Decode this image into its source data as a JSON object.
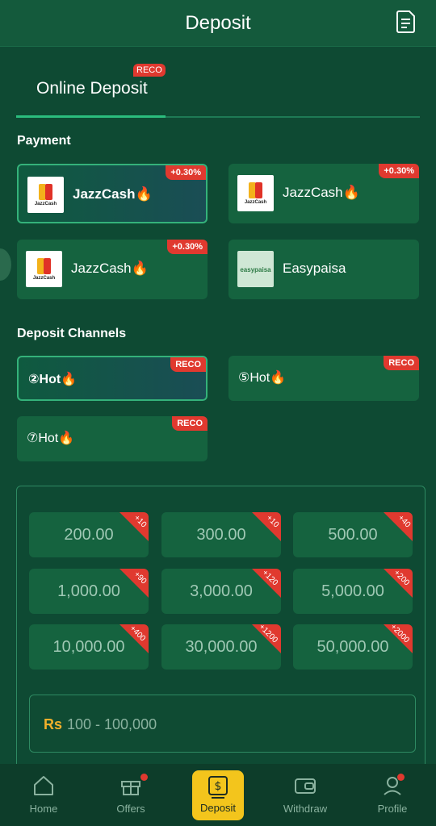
{
  "header": {
    "title": "Deposit"
  },
  "tabs": {
    "active_label": "Online Deposit",
    "reco_badge": "RECO"
  },
  "payment": {
    "section_title": "Payment",
    "methods": [
      {
        "name": "JazzCash🔥",
        "bonus": "+0.30%",
        "logo_caption": "JazzCash",
        "selected": true
      },
      {
        "name": "JazzCash🔥",
        "bonus": "+0.30%",
        "logo_caption": "JazzCash",
        "selected": false
      },
      {
        "name": "JazzCash🔥",
        "bonus": "+0.30%",
        "logo_caption": "JazzCash",
        "selected": false
      },
      {
        "name": "Easypaisa",
        "bonus": "",
        "logo_caption": "easypaisa",
        "selected": false
      }
    ]
  },
  "channels": {
    "section_title": "Deposit Channels",
    "items": [
      {
        "name": "②Hot🔥",
        "badge": "RECO",
        "selected": true
      },
      {
        "name": "⑤Hot🔥",
        "badge": "RECO",
        "selected": false
      },
      {
        "name": "⑦Hot🔥",
        "badge": "RECO",
        "selected": false
      }
    ]
  },
  "amounts": [
    {
      "value": "200.00",
      "bonus": "+10"
    },
    {
      "value": "300.00",
      "bonus": "+10"
    },
    {
      "value": "500.00",
      "bonus": "+40"
    },
    {
      "value": "1,000.00",
      "bonus": "+90"
    },
    {
      "value": "3,000.00",
      "bonus": "+120"
    },
    {
      "value": "5,000.00",
      "bonus": "+200"
    },
    {
      "value": "10,000.00",
      "bonus": "+400"
    },
    {
      "value": "30,000.00",
      "bonus": "+1200"
    },
    {
      "value": "50,000.00",
      "bonus": "+2000"
    }
  ],
  "amount_input": {
    "currency": "Rs",
    "placeholder": "100 - 100,000"
  },
  "nav": {
    "home": "Home",
    "offers": "Offers",
    "deposit": "Deposit",
    "withdraw": "Withdraw",
    "profile": "Profile"
  },
  "colors": {
    "accent": "#f3c51c",
    "badge": "#e0392f",
    "background": "#0e4a33"
  }
}
